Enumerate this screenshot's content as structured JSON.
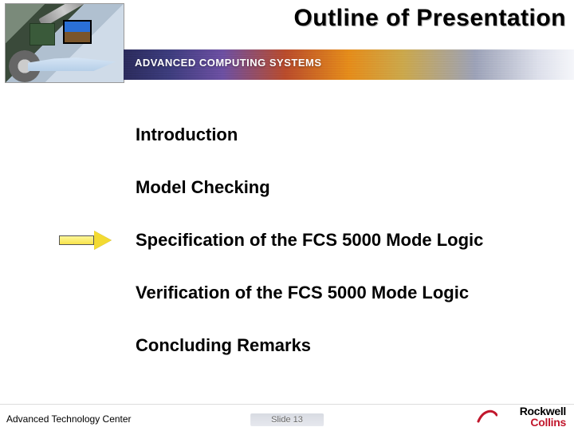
{
  "header": {
    "title": "Outline of Presentation",
    "band_text": "ADVANCED COMPUTING SYSTEMS"
  },
  "outline": {
    "items": [
      {
        "label": "Introduction"
      },
      {
        "label": "Model Checking"
      },
      {
        "label": "Specification of the FCS 5000 Mode Logic"
      },
      {
        "label": "Verification of the FCS 5000 Mode Logic"
      },
      {
        "label": "Concluding Remarks"
      }
    ],
    "pointer_index": 2
  },
  "footer": {
    "left": "Advanced Technology Center",
    "center": "Slide 13",
    "logo_top": "Rockwell",
    "logo_bottom": "Collins"
  }
}
